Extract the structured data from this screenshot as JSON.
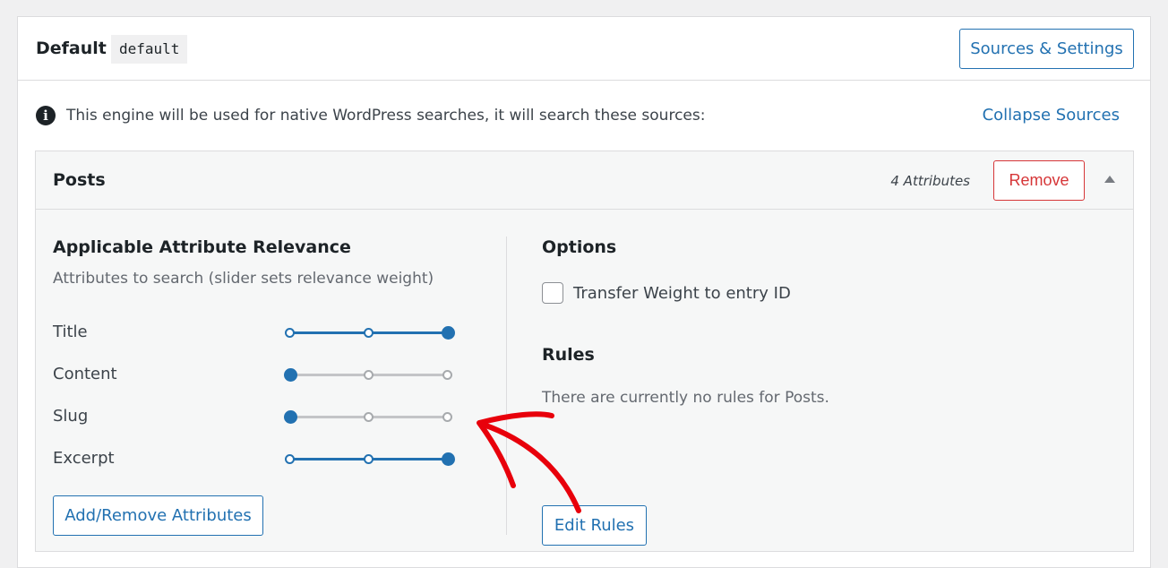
{
  "engine": {
    "title": "Default",
    "slug": "default",
    "sources_settings_label": "Sources & Settings",
    "info_text": "This engine will be used for native WordPress searches, it will search these sources:",
    "collapse_label": "Collapse Sources"
  },
  "source": {
    "title": "Posts",
    "attribute_count": "4 Attributes",
    "remove_label": "Remove"
  },
  "relevance": {
    "title": "Applicable Attribute Relevance",
    "subtitle": "Attributes to search (slider sets relevance weight)",
    "attributes": [
      {
        "label": "Title",
        "weight_level": 3
      },
      {
        "label": "Content",
        "weight_level": 1
      },
      {
        "label": "Slug",
        "weight_level": 1
      },
      {
        "label": "Excerpt",
        "weight_level": 3
      }
    ],
    "add_remove_label": "Add/Remove Attributes"
  },
  "options": {
    "title": "Options",
    "transfer_weight_label": "Transfer Weight to entry ID",
    "transfer_weight_checked": false
  },
  "rules": {
    "title": "Rules",
    "empty_text": "There are currently no rules for Posts.",
    "edit_label": "Edit Rules"
  },
  "colors": {
    "accent": "#2271b1",
    "danger": "#d63638",
    "annotation": "#e8000b"
  }
}
